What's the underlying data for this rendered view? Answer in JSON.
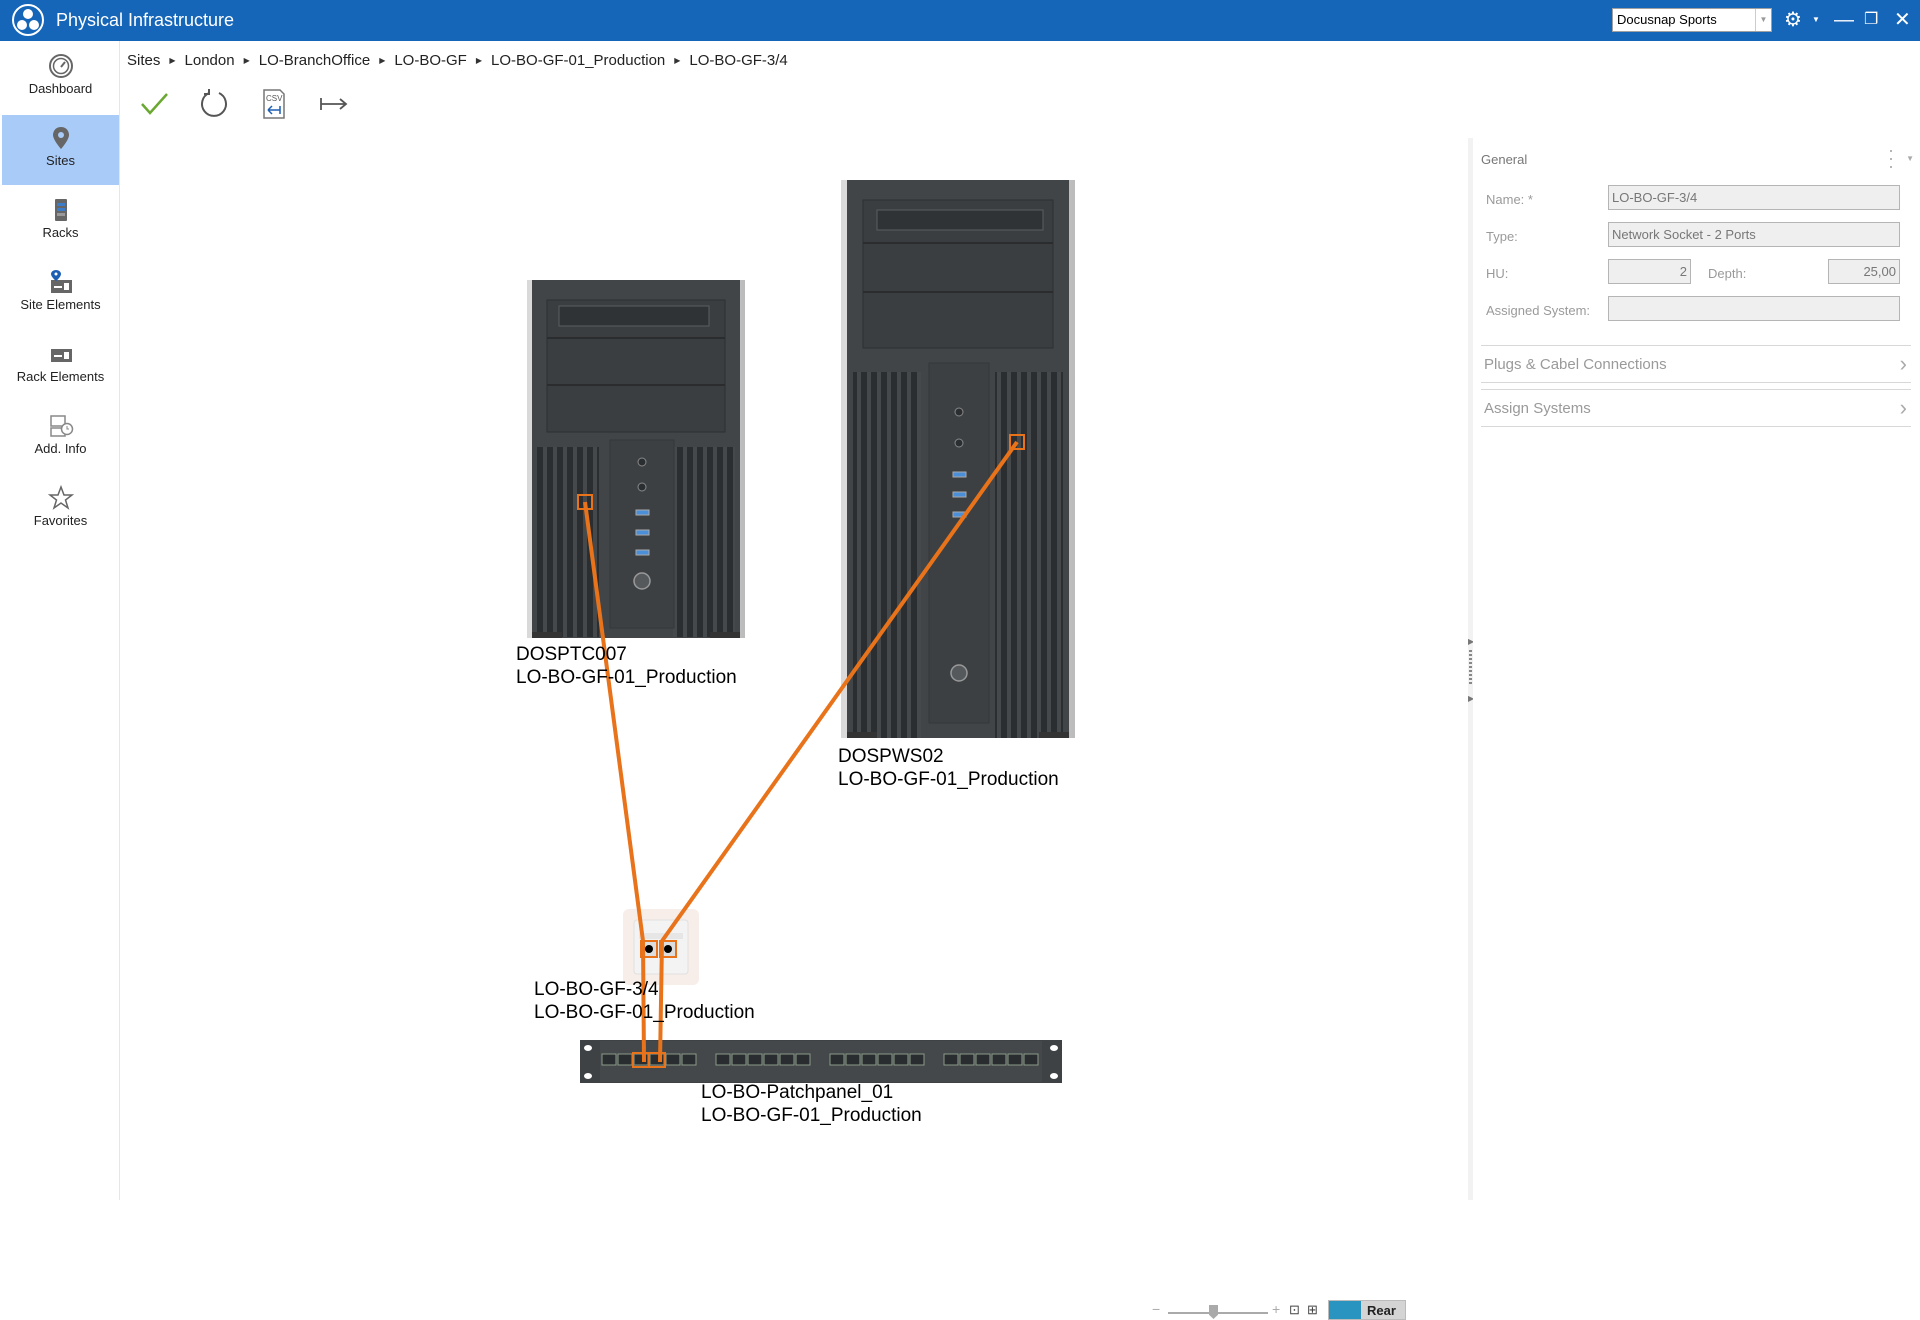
{
  "window": {
    "title": "Physical Infrastructure",
    "tenant_selector": "Docusnap Sports",
    "icons": [
      "settings-gear-icon",
      "minimize-icon",
      "restore-icon",
      "close-icon"
    ]
  },
  "sidebar": {
    "items": [
      {
        "label": "Dashboard",
        "icon": "dashboard-gauge-icon",
        "active": false
      },
      {
        "label": "Sites",
        "icon": "map-pin-icon",
        "active": true
      },
      {
        "label": "Racks",
        "icon": "rack-icon",
        "active": false
      },
      {
        "label": "Site Elements",
        "icon": "site-elements-icon",
        "active": false
      },
      {
        "label": "Rack Elements",
        "icon": "rack-elements-icon",
        "active": false
      },
      {
        "label": "Add. Info",
        "icon": "add-info-icon",
        "active": false
      },
      {
        "label": "Favorites",
        "icon": "star-icon",
        "active": false
      }
    ]
  },
  "breadcrumb": [
    "Sites",
    "London",
    "LO-BranchOffice",
    "LO-BO-GF",
    "LO-BO-GF-01_Production",
    "LO-BO-GF-3/4"
  ],
  "toolbar": {
    "save_icon": "checkmark-icon",
    "refresh_icon": "refresh-icon",
    "csv_import_icon": "csv-import-icon",
    "export_icon": "arrow-to-right-icon",
    "csv_label": "CSV"
  },
  "diagram": {
    "devices": [
      {
        "name": "DOSPTC007",
        "location": "LO-BO-GF-01_Production",
        "kind": "tower-pc"
      },
      {
        "name": "DOSPWS02",
        "location": "LO-BO-GF-01_Production",
        "kind": "tower-pc"
      },
      {
        "name": "LO-BO-GF-3/4",
        "location": "LO-BO-GF-01_Production",
        "kind": "network-socket"
      },
      {
        "name": "LO-BO-Patchpanel_01",
        "location": "LO-BO-GF-01_Production",
        "kind": "patch-panel",
        "ports": 24
      }
    ],
    "cable_color": "#e8731a",
    "connections": [
      {
        "from": "DOSPTC007",
        "to": "LO-BO-GF-3/4 port 1"
      },
      {
        "from": "DOSPWS02",
        "to": "LO-BO-GF-3/4 port 2"
      },
      {
        "from": "LO-BO-GF-3/4 port 1",
        "to": "LO-BO-Patchpanel_01 port 3"
      },
      {
        "from": "LO-BO-GF-3/4 port 2",
        "to": "LO-BO-Patchpanel_01 port 4"
      }
    ]
  },
  "zoom_control": {
    "minus": "−",
    "plus": "+",
    "view_toggle": "Rear"
  },
  "panel": {
    "header": "General",
    "fields": {
      "name_label": "Name: *",
      "name_value": "LO-BO-GF-3/4",
      "type_label": "Type:",
      "type_value": "Network Socket - 2 Ports",
      "hu_label": "HU:",
      "hu_value": "2",
      "depth_label": "Depth:",
      "depth_value": "25,00",
      "assigned_label": "Assigned System:",
      "assigned_value": ""
    },
    "sections": [
      "Plugs & Cabel Connections",
      "Assign Systems"
    ]
  }
}
